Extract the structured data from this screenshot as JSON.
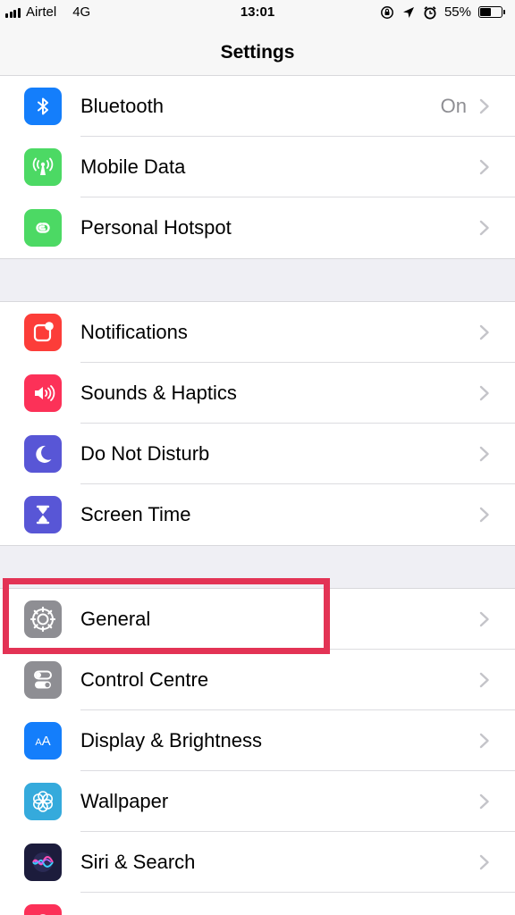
{
  "status_bar": {
    "carrier": "Airtel",
    "network": "4G",
    "time": "13:01",
    "battery_percent": "55%",
    "battery_level": 0.55,
    "icons": [
      "orientation-lock-icon",
      "location-icon",
      "alarm-icon"
    ]
  },
  "nav": {
    "title": "Settings"
  },
  "groups": [
    {
      "rows": [
        {
          "label": "Bluetooth",
          "value": "On",
          "icon": "bluetooth-icon",
          "icon_color": "#147efb"
        },
        {
          "label": "Mobile Data",
          "icon": "antenna-icon",
          "icon_color": "#4cd964"
        },
        {
          "label": "Personal Hotspot",
          "icon": "hotspot-icon",
          "icon_color": "#4cd964"
        }
      ]
    },
    {
      "rows": [
        {
          "label": "Notifications",
          "icon": "notifications-icon",
          "icon_color": "#fc3d39"
        },
        {
          "label": "Sounds & Haptics",
          "icon": "speaker-icon",
          "icon_color": "#fc3158"
        },
        {
          "label": "Do Not Disturb",
          "icon": "moon-icon",
          "icon_color": "#5856d6"
        },
        {
          "label": "Screen Time",
          "icon": "hourglass-icon",
          "icon_color": "#5856d6"
        }
      ]
    },
    {
      "rows": [
        {
          "label": "General",
          "icon": "gear-icon",
          "icon_color": "#8e8e93"
        },
        {
          "label": "Control Centre",
          "icon": "toggles-icon",
          "icon_color": "#8e8e93"
        },
        {
          "label": "Display & Brightness",
          "icon": "text-size-icon",
          "icon_color": "#147efb"
        },
        {
          "label": "Wallpaper",
          "icon": "flower-icon",
          "icon_color": "#35aadc"
        },
        {
          "label": "Siri & Search",
          "icon": "siri-icon",
          "icon_color": "#1c1c3c"
        },
        {
          "label": "",
          "icon": "touch-id-icon",
          "icon_color": "#fc3158"
        }
      ]
    }
  ],
  "highlight": {
    "target": "General",
    "color": "#e33355"
  }
}
